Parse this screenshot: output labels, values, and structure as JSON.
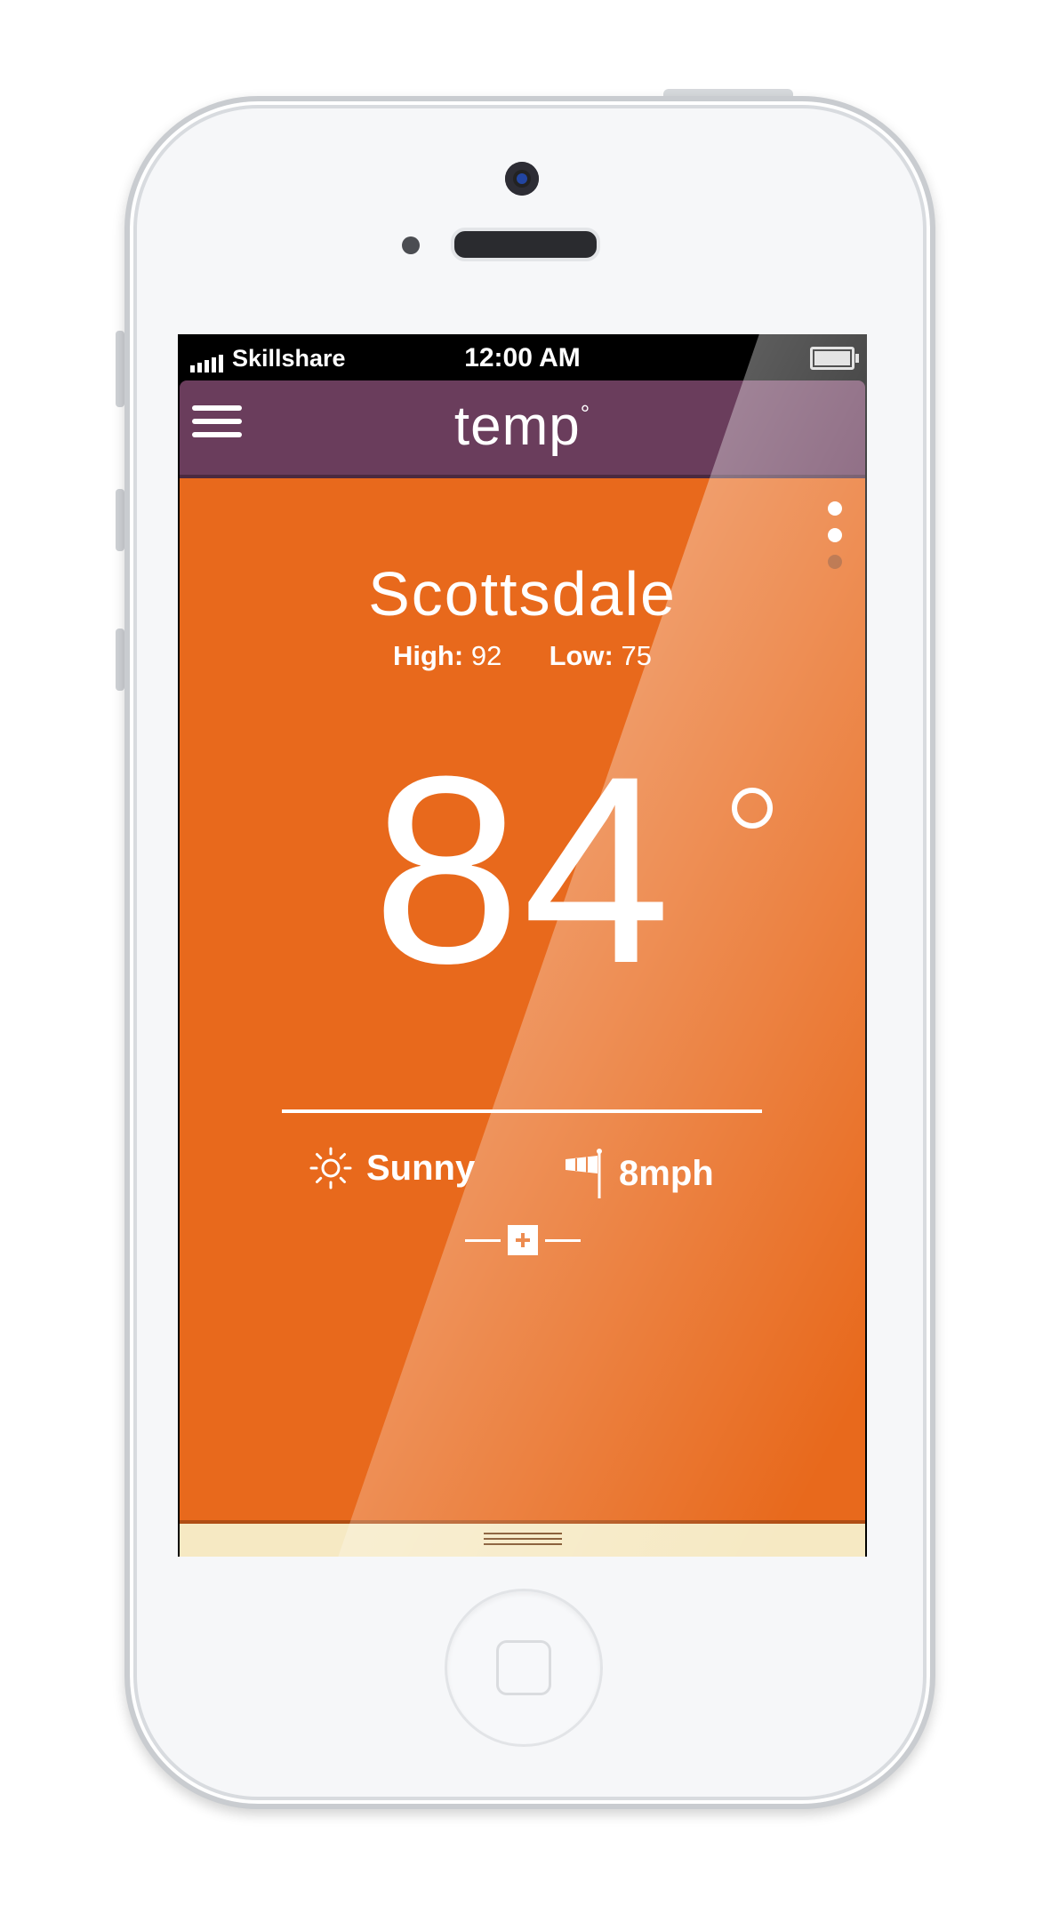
{
  "status_bar": {
    "carrier": "Skillshare",
    "time": "12:00 AM",
    "signal_bars": 5,
    "battery_level": 1.0
  },
  "app": {
    "title": "temp",
    "title_mark": "°",
    "menu_icon": "hamburger-menu-icon"
  },
  "location": {
    "city": "Scottsdale",
    "high_label": "High:",
    "high_value": "92",
    "low_label": "Low:",
    "low_value": "75"
  },
  "current": {
    "temperature": "84",
    "degree_icon": "degree-icon",
    "condition": "Sunny",
    "condition_icon": "sun-icon",
    "wind": "8mph",
    "wind_icon": "windsock-icon",
    "more_icon": "plus-icon"
  },
  "page_indicator": {
    "pages": 3,
    "active_pages": [
      0,
      1
    ]
  },
  "colors": {
    "navbar": "#6a3d5c",
    "background": "#e8691c",
    "drawer": "#f6e9c3",
    "text": "#ffffff"
  }
}
